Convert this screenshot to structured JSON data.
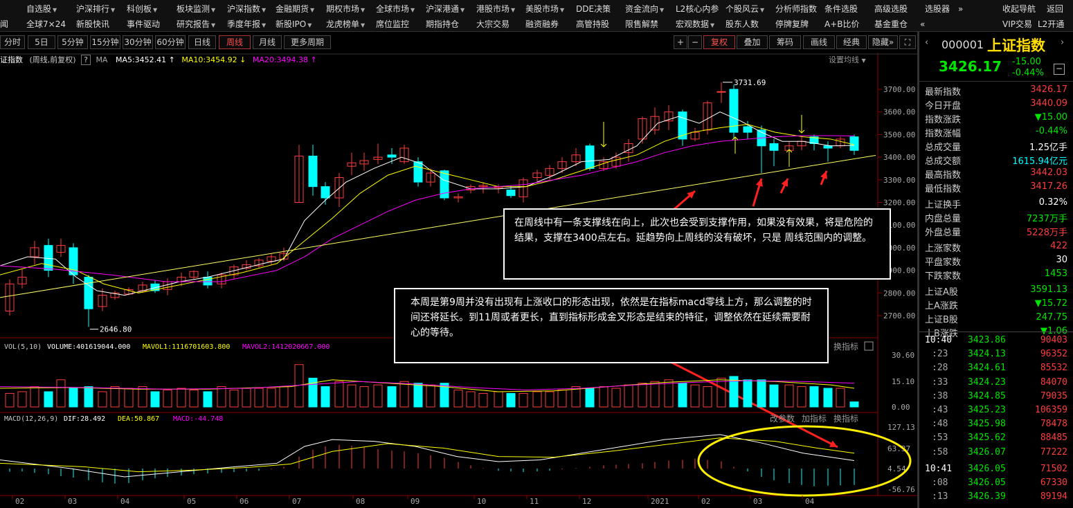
{
  "menu": {
    "row1": [
      {
        "label": "自选股",
        "arrow": true
      },
      {
        "label": "沪深排行",
        "arrow": true
      },
      {
        "label": "科创板",
        "arrow": true
      },
      {
        "label": "板块监测",
        "arrow": true
      },
      {
        "label": "沪深指数",
        "arrow": true
      },
      {
        "label": "金融期货",
        "arrow": true
      },
      {
        "label": "期权市场",
        "arrow": true
      },
      {
        "label": "全球市场",
        "arrow": true
      },
      {
        "label": "沪深港通",
        "arrow": true
      },
      {
        "label": "港股市场",
        "arrow": true
      },
      {
        "label": "美股市场",
        "arrow": true
      },
      {
        "label": "DDE决策",
        "arrow": false
      },
      {
        "label": "资金流向",
        "arrow": true
      },
      {
        "label": "L2核心内参",
        "arrow": false
      },
      {
        "label": "个股风云",
        "arrow": true
      },
      {
        "label": "分析师指数",
        "arrow": false
      },
      {
        "label": "条件选股",
        "arrow": false
      },
      {
        "label": "高级选股",
        "arrow": false
      },
      {
        "label": "选股器",
        "arrow": false
      },
      {
        "label": "»",
        "arrow": false
      },
      {
        "label": "收起导航",
        "arrow": false
      },
      {
        "label": "返回",
        "arrow": false
      }
    ],
    "row2": [
      {
        "label": "闻"
      },
      {
        "label": "全球7×24"
      },
      {
        "label": "新股快讯"
      },
      {
        "label": "事件驱动"
      },
      {
        "label": "研究报告",
        "arrow": true
      },
      {
        "label": "季度年报",
        "arrow": true
      },
      {
        "label": "新股IPO",
        "arrow": true
      },
      {
        "label": "龙虎榜单",
        "arrow": true
      },
      {
        "label": "席位监控"
      },
      {
        "label": "期指持仓"
      },
      {
        "label": "大宗交易"
      },
      {
        "label": "融资融券"
      },
      {
        "label": "高管持股"
      },
      {
        "label": "限售解禁"
      },
      {
        "label": "宏观数据",
        "arrow": true
      },
      {
        "label": "股东人数"
      },
      {
        "label": "停牌复牌"
      },
      {
        "label": "A+B比价"
      },
      {
        "label": "基金重仓"
      },
      {
        "label": "«"
      },
      {
        "label": "VIP交易"
      },
      {
        "label": "L2开通"
      }
    ]
  },
  "toolbar": {
    "periods": [
      "分时",
      "5日",
      "5分钟",
      "15分钟",
      "30分钟",
      "60分钟",
      "日线",
      "周线",
      "月线",
      "更多周期"
    ],
    "active_period": "周线",
    "right_buttons": [
      "+",
      "−",
      "复权",
      "叠加",
      "筹码",
      "画线",
      "经典",
      "隐藏»",
      "⛶"
    ]
  },
  "chart_header": {
    "name": "证指数",
    "meta": "(周线,前复权)",
    "help": "?",
    "ma_label": "MA",
    "ma5": "MA5:3452.41",
    "ma10": "MA10:3454.92",
    "ma20": "MA20:3494.38",
    "settings": "设置均线"
  },
  "price_axis": [
    "3700.00",
    "3600.00",
    "3500.00",
    "3400.00",
    "3300.00",
    "3200.00",
    "3100.00",
    "3000.00",
    "2900.00",
    "2800.00",
    "2700.00"
  ],
  "price_labels": {
    "high": "3731.69",
    "low": "2646.80"
  },
  "volume_header": {
    "title": "VOL(5,10)",
    "volume": "VOLUME:401619044.000",
    "mavol1": "MAVOL1:1116701603.800",
    "mavol2": "MAVOL2:1412020667.000",
    "actions": [
      "改参数",
      "加指标",
      "换指标"
    ]
  },
  "volume_axis": [
    "30.60",
    "15.10",
    "0.00"
  ],
  "macd_header": {
    "title": "MACD(12,26,9)",
    "dif": "DIF:28.492",
    "dea": "DEA:50.867",
    "macd": "MACD:-44.748",
    "actions": [
      "改参数",
      "加指标",
      "换指标"
    ]
  },
  "macd_axis": [
    "127.13",
    "63.37",
    "4.54",
    "-56.76"
  ],
  "date_axis": [
    "02",
    "03",
    "04",
    "05",
    "06",
    "07",
    "08",
    "09",
    "10",
    "11",
    "12",
    "2021",
    "02",
    "03",
    "04"
  ],
  "annotations": {
    "box1": "在周线中有一条支撑线在向上，此次也会受到支撑作用，如果没有效果，将是危险的结果，支撑在3400点左右。延趋势向上周线的没有破坏，只是 周线范围内的调整。",
    "box2": "本周是第9周并没有出现有上涨收口的形态出现，依然是在指标macd零线上方，那么调整的时间还将延长。到11周或者更长，直到指标形成金叉形态是结束的特征，调整依然在延续需要耐心的等待。"
  },
  "right_panel": {
    "code": "000001",
    "name": "上证指数",
    "price": "3426.17",
    "change": "-15.00",
    "change_pct": "-0.44%",
    "stats": [
      {
        "label": "最新指数",
        "value": "3426.17",
        "color": "red"
      },
      {
        "label": "今日开盘",
        "value": "3440.09",
        "color": "red"
      },
      {
        "label": "指数涨跌",
        "value": "▼15.00",
        "color": "green"
      },
      {
        "label": "指数涨幅",
        "value": "-0.44%",
        "color": "green"
      },
      {
        "label": "总成交量",
        "value": "1.25亿手",
        "color": "white"
      },
      {
        "label": "总成交额",
        "value": "1615.94亿元",
        "color": "cyan"
      },
      {
        "label": "最高指数",
        "value": "3442.03",
        "color": "red"
      },
      {
        "label": "最低指数",
        "value": "3417.26",
        "color": "red"
      },
      {
        "label": "上证换手",
        "value": "0.32%",
        "color": "white"
      },
      {
        "label": "内盘总量",
        "value": "7237万手",
        "color": "green"
      },
      {
        "label": "外盘总量",
        "value": "5228万手",
        "color": "red"
      },
      {
        "label": "上涨家数",
        "value": "422",
        "color": "red"
      },
      {
        "label": "平盘家数",
        "value": "30",
        "color": "white"
      },
      {
        "label": "下跌家数",
        "value": "1453",
        "color": "green"
      },
      {
        "label": "上证A股",
        "value": "3591.13",
        "color": "green"
      },
      {
        "label": "上A涨跌",
        "value": "▼15.72",
        "color": "green"
      },
      {
        "label": "上证B股",
        "value": "247.75",
        "color": "green"
      },
      {
        "label": "上B涨跌",
        "value": "▼1.06",
        "color": "green"
      }
    ],
    "ticks": [
      {
        "time": "10:40",
        "price": "3423.86",
        "vol": "90403"
      },
      {
        "time": ":23",
        "price": "3424.13",
        "vol": "96352"
      },
      {
        "time": ":28",
        "price": "3424.61",
        "vol": "85532"
      },
      {
        "time": ":33",
        "price": "3424.23",
        "vol": "84070"
      },
      {
        "time": ":38",
        "price": "3424.85",
        "vol": "79035"
      },
      {
        "time": ":43",
        "price": "3425.23",
        "vol": "106359"
      },
      {
        "time": ":48",
        "price": "3425.98",
        "vol": "78478"
      },
      {
        "time": ":53",
        "price": "3425.62",
        "vol": "88485"
      },
      {
        "time": ":58",
        "price": "3426.07",
        "vol": "77222"
      },
      {
        "time": "10:41",
        "price": "3426.05",
        "vol": "71502"
      },
      {
        "time": ":08",
        "price": "3426.05",
        "vol": "67330"
      },
      {
        "time": ":13",
        "price": "3426.39",
        "vol": "89194"
      }
    ]
  },
  "colors": {
    "up": "#ff3c3c",
    "down": "#00ffff",
    "ma5": "#ffffff",
    "ma10": "#ffff00",
    "ma20": "#ff00ff",
    "support_line": "#ffff66",
    "arrow": "#ff2020",
    "circle": "#ffee00"
  }
}
